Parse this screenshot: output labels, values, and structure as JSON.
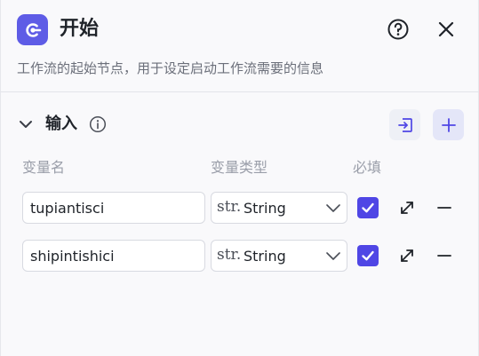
{
  "header": {
    "title": "开始",
    "description": "工作流的起始节点，用于设定启动工作流需要的信息",
    "app_icon": "node-start-icon",
    "help_icon": "help-circle-icon",
    "close_icon": "close-icon"
  },
  "section": {
    "title": "输入",
    "info_icon": "info-icon",
    "import_icon": "import-icon",
    "add_icon": "plus-icon"
  },
  "columns": {
    "name": "变量名",
    "type": "变量类型",
    "required": "必填"
  },
  "variables": [
    {
      "name": "tupiantisci",
      "type_prefix": "str.",
      "type": "String",
      "required": true
    },
    {
      "name": "shipintishici",
      "type_prefix": "str.",
      "type": "String",
      "required": true
    }
  ],
  "colors": {
    "accent": "#5e5ce6",
    "checkbox": "#4f46e5",
    "add_button_bg": "#e4e6f8"
  }
}
